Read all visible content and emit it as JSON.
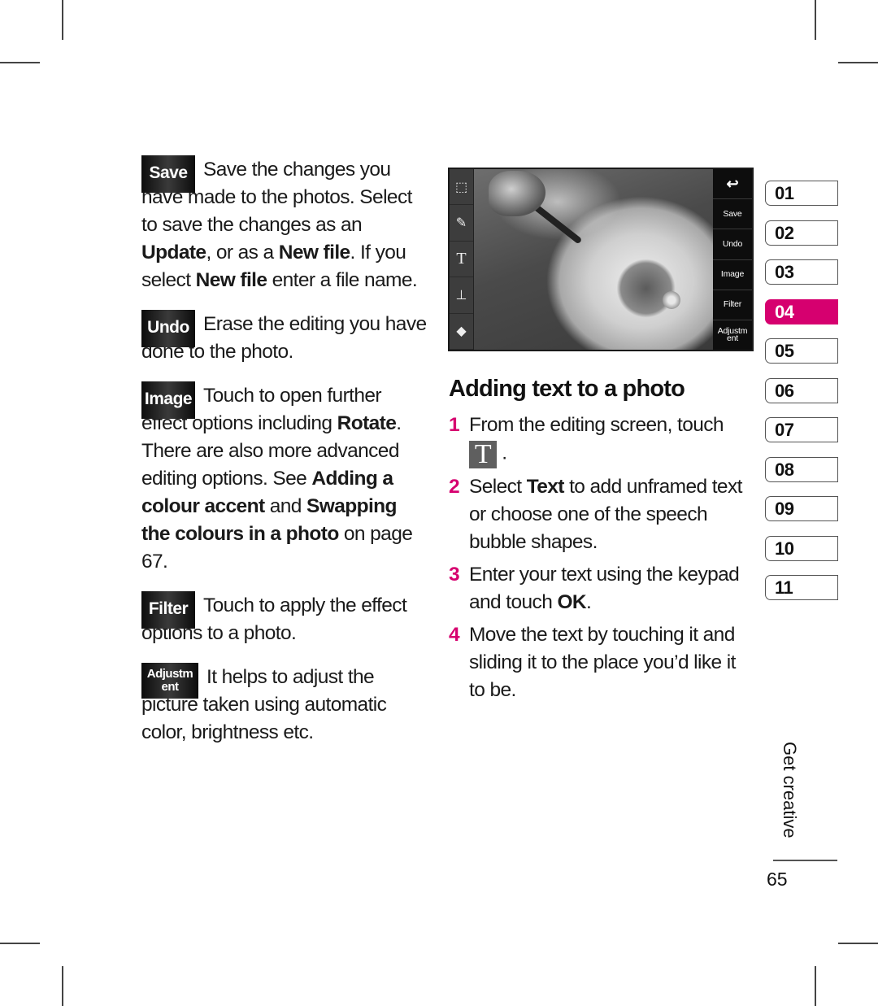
{
  "left_column": {
    "items": [
      {
        "button_label": "Save",
        "text_parts": [
          {
            "t": "Save the changes you have made to the photos. Select to save the changes as an ",
            "b": false
          },
          {
            "t": "Update",
            "b": true
          },
          {
            "t": ", or as a ",
            "b": false
          },
          {
            "t": "New file",
            "b": true
          },
          {
            "t": ". If you select ",
            "b": false
          },
          {
            "t": "New file",
            "b": true
          },
          {
            "t": " enter a file name.",
            "b": false
          }
        ]
      },
      {
        "button_label": "Undo",
        "text_parts": [
          {
            "t": "Erase the editing you have done to the photo.",
            "b": false
          }
        ]
      },
      {
        "button_label": "Image",
        "text_parts": [
          {
            "t": "Touch to open further effect options including ",
            "b": false
          },
          {
            "t": "Rotate",
            "b": true
          },
          {
            "t": ". There are also more advanced editing options. See ",
            "b": false
          },
          {
            "t": "Adding a colour accent",
            "b": true
          },
          {
            "t": " and ",
            "b": false
          },
          {
            "t": "Swapping the colours in a photo",
            "b": true
          },
          {
            "t": " on page 67.",
            "b": false
          }
        ]
      },
      {
        "button_label": "Filter",
        "text_parts": [
          {
            "t": "Touch to apply the effect options to a photo.",
            "b": false
          }
        ]
      },
      {
        "button_label_line1": "Adjustm",
        "button_label_line2": "ent",
        "text_parts": [
          {
            "t": "It helps to adjust the picture taken using automatic color, brightness etc.",
            "b": false
          }
        ]
      }
    ]
  },
  "editor_screenshot": {
    "left_tools": [
      {
        "icon": "select-area-icon",
        "glyph": "⬚"
      },
      {
        "icon": "pencil-icon",
        "glyph": "✎"
      },
      {
        "icon": "text-icon",
        "glyph": "T"
      },
      {
        "icon": "stamp-icon",
        "glyph": "⊥"
      },
      {
        "icon": "eraser-icon",
        "glyph": "◆"
      }
    ],
    "right_tools": {
      "back_glyph": "↩",
      "save": "Save",
      "undo": "Undo",
      "image": "Image",
      "filter": "Filter",
      "adjust_line1": "Adjustm",
      "adjust_line2": "ent"
    }
  },
  "section": {
    "title": "Adding text to a photo",
    "steps": [
      {
        "num": "1",
        "parts": [
          {
            "t": "From the editing screen, touch",
            "b": false
          }
        ],
        "icon_glyph": "T",
        "after_icon": "."
      },
      {
        "num": "2",
        "parts": [
          {
            "t": "Select ",
            "b": false
          },
          {
            "t": "Text",
            "b": true
          },
          {
            "t": " to add unframed text or choose one of the speech bubble shapes.",
            "b": false
          }
        ]
      },
      {
        "num": "3",
        "parts": [
          {
            "t": "Enter your text using the keypad and touch ",
            "b": false
          },
          {
            "t": "OK",
            "b": true
          },
          {
            "t": ".",
            "b": false
          }
        ]
      },
      {
        "num": "4",
        "parts": [
          {
            "t": "Move the text by touching it and sliding it to the place you’d like it to be.",
            "b": false
          }
        ]
      }
    ]
  },
  "chapter_tabs": {
    "items": [
      "01",
      "02",
      "03",
      "04",
      "05",
      "06",
      "07",
      "08",
      "09",
      "10",
      "11"
    ],
    "active": "04",
    "accent_color": "#d6006f"
  },
  "footer": {
    "section_label": "Get creative",
    "page_number": "65"
  }
}
